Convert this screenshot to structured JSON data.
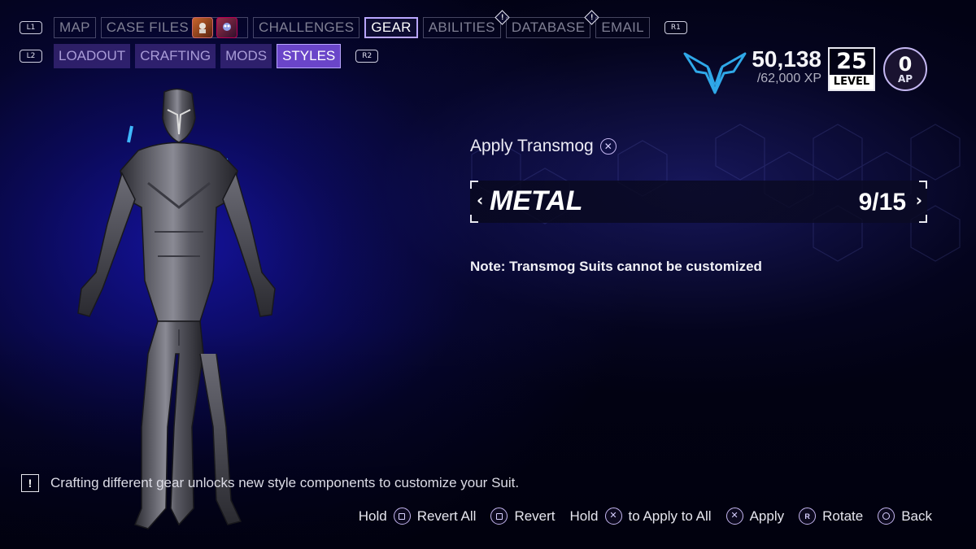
{
  "nav": {
    "l1": "L1",
    "r1": "R1",
    "l2": "L2",
    "r2": "R2",
    "tabs": [
      {
        "label": "MAP"
      },
      {
        "label": "CASE FILES"
      },
      {
        "label": "CHALLENGES"
      },
      {
        "label": "GEAR",
        "active": true
      },
      {
        "label": "ABILITIES",
        "alert": "!"
      },
      {
        "label": "DATABASE",
        "alert": "!"
      },
      {
        "label": "EMAIL"
      }
    ],
    "subtabs": [
      {
        "label": "LOADOUT"
      },
      {
        "label": "CRAFTING"
      },
      {
        "label": "MODS"
      },
      {
        "label": "STYLES",
        "active": true
      }
    ]
  },
  "player": {
    "emblem_icon": "nightwing-emblem-icon",
    "xp": "50,138",
    "xp_max": "/62,000 XP",
    "level": "25",
    "level_label": "LEVEL",
    "ap": "0",
    "ap_label": "AP"
  },
  "transmog": {
    "title": "Apply Transmog",
    "title_button": "✕",
    "style_name": "METAL",
    "count": "9/15",
    "prev": "‹",
    "next": "›",
    "note": "Note: Transmog Suits cannot be customized"
  },
  "tip": {
    "icon": "!",
    "text": "Crafting different gear unlocks new style components to customize your Suit."
  },
  "footer": {
    "revert_all_pre": "Hold",
    "revert_all": "Revert All",
    "revert": "Revert",
    "apply_all_pre": "Hold",
    "apply_all": "to Apply to All",
    "apply": "Apply",
    "rotate": "Rotate",
    "back": "Back",
    "rotate_glyph": "R"
  },
  "colors": {
    "accent": "#b9a6ff",
    "subtab_bg": "#4e3496",
    "subtab_active": "#6a45c9",
    "emblem": "#2fa8e8"
  }
}
